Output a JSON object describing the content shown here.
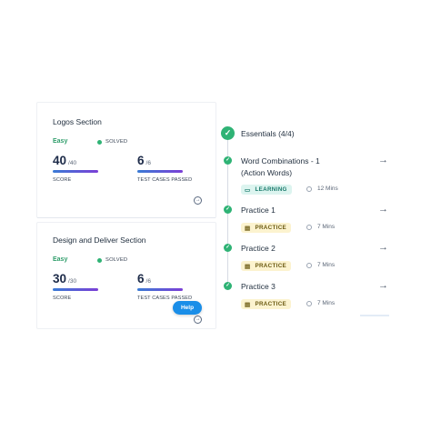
{
  "left_cards": [
    {
      "title": "Logos Section",
      "difficulty": "Easy",
      "status": "SOLVED",
      "score": {
        "value": "40",
        "total": "/40",
        "label": "SCORE"
      },
      "tests": {
        "value": "6",
        "total": "/6",
        "label": "TEST CASES PASSED"
      }
    },
    {
      "title": "Design and Deliver Section",
      "difficulty": "Easy",
      "status": "SOLVED",
      "score": {
        "value": "30",
        "total": "/30",
        "label": "SCORE"
      },
      "tests": {
        "value": "6",
        "total": "/6",
        "label": "TEST CASES PASSED"
      }
    }
  ],
  "help_button": {
    "label": "Help"
  },
  "section": {
    "title": "Essentials (4/4)",
    "icon": "check-icon"
  },
  "items": [
    {
      "title": "Word Combinations - 1 (Action Words)",
      "tag": "LEARNING",
      "tag_icon": "book-icon",
      "duration": "12 Mins"
    },
    {
      "title": "Practice 1",
      "tag": "PRACTICE",
      "tag_icon": "clipboard-icon",
      "duration": "7 Mins"
    },
    {
      "title": "Practice 2",
      "tag": "PRACTICE",
      "tag_icon": "clipboard-icon",
      "duration": "7 Mins"
    },
    {
      "title": "Practice 3",
      "tag": "PRACTICE",
      "tag_icon": "clipboard-icon",
      "duration": "7 Mins"
    }
  ],
  "colors": {
    "success": "#2fb375",
    "easy": "#2e9d6a",
    "accent": "#1a8ee8",
    "learning_bg": "#dcf4ef",
    "practice_bg": "#fcf3cf"
  }
}
